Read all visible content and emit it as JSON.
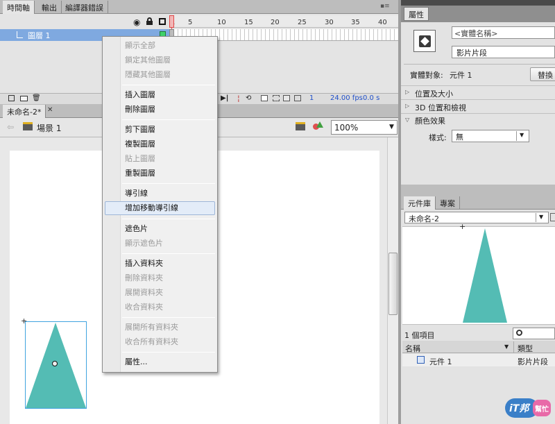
{
  "timeline_tabs": [
    "時間軸",
    "輸出",
    "編譯器錯誤"
  ],
  "timeline": {
    "layer_name": "圖層 1",
    "ruler": [
      "1",
      "5",
      "10",
      "15",
      "20",
      "25",
      "30",
      "35",
      "40"
    ],
    "frame": "1",
    "fps": "24.00 fps",
    "time": "0.0 s"
  },
  "document_tab": "未命名-2*",
  "breadcrumb": {
    "scene": "場景 1"
  },
  "zoom": "100%",
  "context_menu": {
    "items": [
      {
        "label": "顯示全部",
        "enabled": false
      },
      {
        "label": "鎖定其他圖層",
        "enabled": false
      },
      {
        "label": "隱藏其他圖層",
        "enabled": false
      },
      {
        "label": "插入圖層",
        "enabled": true
      },
      {
        "label": "刪除圖層",
        "enabled": true
      },
      {
        "label": "剪下圖層",
        "enabled": true
      },
      {
        "label": "複製圖層",
        "enabled": true
      },
      {
        "label": "貼上圖層",
        "enabled": false
      },
      {
        "label": "重製圖層",
        "enabled": true
      },
      {
        "label": "導引線",
        "enabled": true
      },
      {
        "label": "增加移動導引線",
        "enabled": true
      },
      {
        "label": "遮色片",
        "enabled": true
      },
      {
        "label": "顯示遮色片",
        "enabled": false
      },
      {
        "label": "插入資料夾",
        "enabled": true
      },
      {
        "label": "刪除資料夾",
        "enabled": false
      },
      {
        "label": "展開資料夾",
        "enabled": false
      },
      {
        "label": "收合資料夾",
        "enabled": false
      },
      {
        "label": "展開所有資料夾",
        "enabled": false
      },
      {
        "label": "收合所有資料夾",
        "enabled": false
      },
      {
        "label": "屬性...",
        "enabled": true
      }
    ]
  },
  "properties": {
    "tab": "屬性",
    "instance_name_placeholder": "<實體名稱>",
    "type": "影片片段",
    "instance_of_label": "實體對象:",
    "instance_of_value": "元件 1",
    "swap_button": "替換",
    "sections": [
      "位置及大小",
      "3D 位置和檢視",
      "顏色效果"
    ],
    "style_label": "樣式:",
    "style_value": "無"
  },
  "library": {
    "tabs": [
      "元件庫",
      "專案"
    ],
    "document": "未命名-2",
    "count": "1 個項目",
    "columns": [
      "名稱",
      "類型"
    ],
    "items": [
      {
        "name": "元件 1",
        "type": "影片片段"
      }
    ]
  },
  "watermark": {
    "logo_text": "iT邦",
    "sub_text": "幫忙"
  },
  "colors": {
    "symbol_fill": "#54bcb4",
    "selection": "#7fa9e0",
    "highlight": "#e3ecf8",
    "playhead": "#e04848"
  }
}
